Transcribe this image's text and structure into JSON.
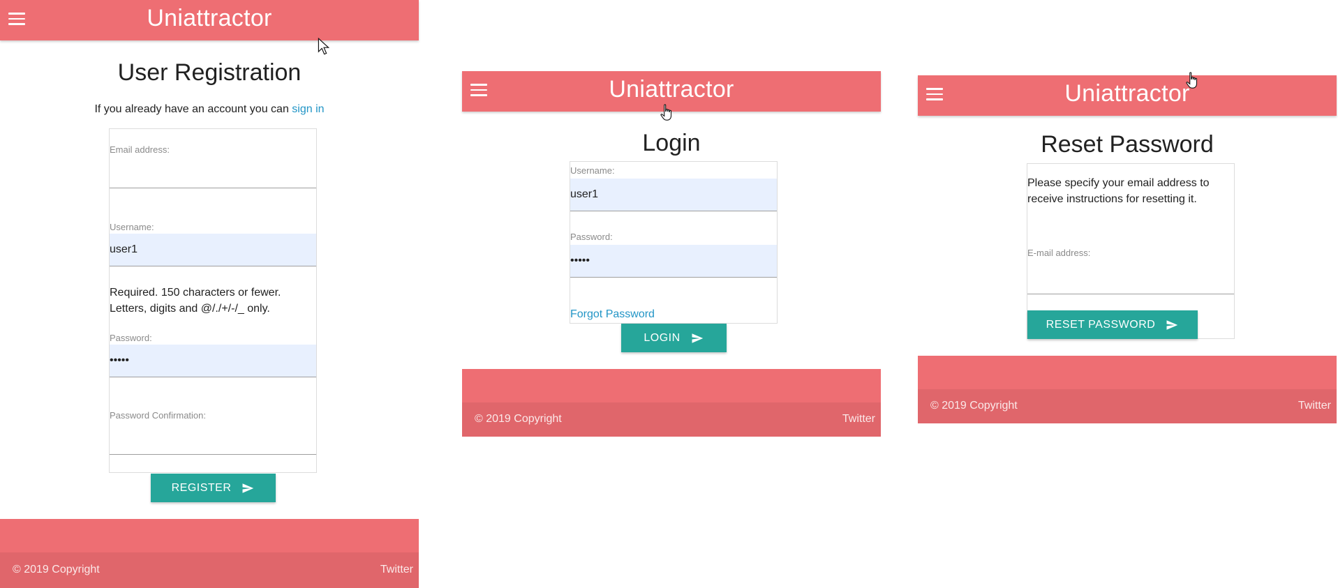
{
  "app": {
    "brand": "Uniattractor",
    "primary_color": "#ee6e73",
    "button_color": "#26a69a",
    "link_color": "#2295c6"
  },
  "registration": {
    "heading": "User Registration",
    "intro_text": "If you already have an account you can ",
    "intro_link": "sign in",
    "email_label": "Email address:",
    "email_value": "",
    "username_label": "Username:",
    "username_value": "user1",
    "username_help_line1": "Required. 150 characters or fewer.",
    "username_help_line2": "Letters, digits and @/./+/-/_ only.",
    "password_label": "Password:",
    "password_value": "•••••",
    "password_confirm_label": "Password Confirmation:",
    "password_confirm_value": "",
    "submit_label": "REGISTER",
    "submit_icon": "send-icon"
  },
  "login": {
    "heading": "Login",
    "username_label": "Username:",
    "username_value": "user1",
    "password_label": "Password:",
    "password_value": "•••••",
    "forgot_link": "Forgot Password",
    "submit_label": "LOGIN",
    "submit_icon": "send-icon"
  },
  "reset": {
    "heading": "Reset Password",
    "instructions_line1": "Please specify your email address to",
    "instructions_line2": "receive instructions for resetting it.",
    "email_label": "E-mail address:",
    "email_value": "",
    "submit_label": "RESET PASSWORD",
    "submit_icon": "send-icon"
  },
  "footer": {
    "copyright": "© 2019 Copyright",
    "twitter": "Twitter"
  }
}
